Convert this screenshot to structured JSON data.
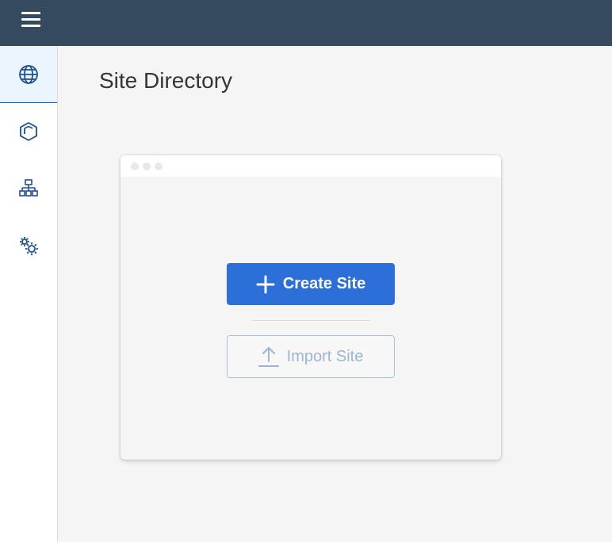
{
  "header": {
    "menu_icon": "hamburger-menu-icon",
    "bg_color": "#354a5f"
  },
  "sidebar": {
    "items": [
      {
        "name": "sites",
        "icon": "globe-icon",
        "active": true
      },
      {
        "name": "content",
        "icon": "cube-icon",
        "active": false
      },
      {
        "name": "structure",
        "icon": "org-chart-icon",
        "active": false
      },
      {
        "name": "settings",
        "icon": "gears-icon",
        "active": false
      }
    ]
  },
  "main": {
    "title": "Site Directory",
    "card": {
      "create_label": "Create Site",
      "create_icon": "plus-icon",
      "import_label": "Import Site",
      "import_icon": "upload-icon"
    }
  },
  "colors": {
    "accent": "#2c6fd8",
    "icon": "#1f4f8f",
    "disabled": "#9cb4d6"
  }
}
